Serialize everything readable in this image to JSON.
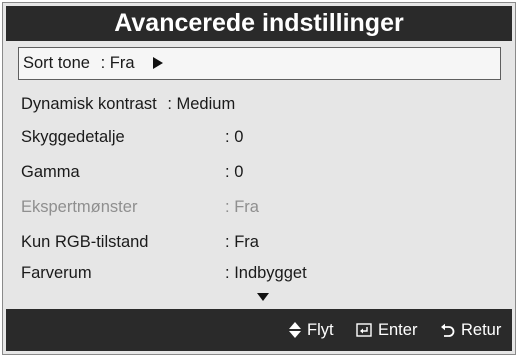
{
  "window": {
    "title": "Avancerede indstillinger"
  },
  "menu": {
    "items": [
      {
        "label": "Sort tone",
        "value": "Fra",
        "selected": true,
        "disabled": false
      },
      {
        "label": "Dynamisk kontrast",
        "value": "Medium",
        "selected": false,
        "disabled": false
      },
      {
        "label": "Skyggedetalje",
        "value": "0",
        "selected": false,
        "disabled": false
      },
      {
        "label": "Gamma",
        "value": "0",
        "selected": false,
        "disabled": false
      },
      {
        "label": "Ekspertmønster",
        "value": "Fra",
        "selected": false,
        "disabled": true
      },
      {
        "label": "Kun RGB-tilstand",
        "value": "Fra",
        "selected": false,
        "disabled": false
      },
      {
        "label": "Farverum",
        "value": "Indbygget",
        "selected": false,
        "disabled": false
      }
    ],
    "separator": ":"
  },
  "footer": {
    "move_label": "Flyt",
    "enter_label": "Enter",
    "return_label": "Retur"
  },
  "icons": {
    "selected_arrow": "right-triangle-icon",
    "scroll": "chevron-down-icon",
    "move": "up-down-arrows-icon",
    "enter": "enter-icon",
    "return": "return-icon"
  },
  "colors": {
    "bar": "#2a2a2a",
    "panel": "#e6e6e6",
    "disabled_text": "#8f8f8f"
  }
}
